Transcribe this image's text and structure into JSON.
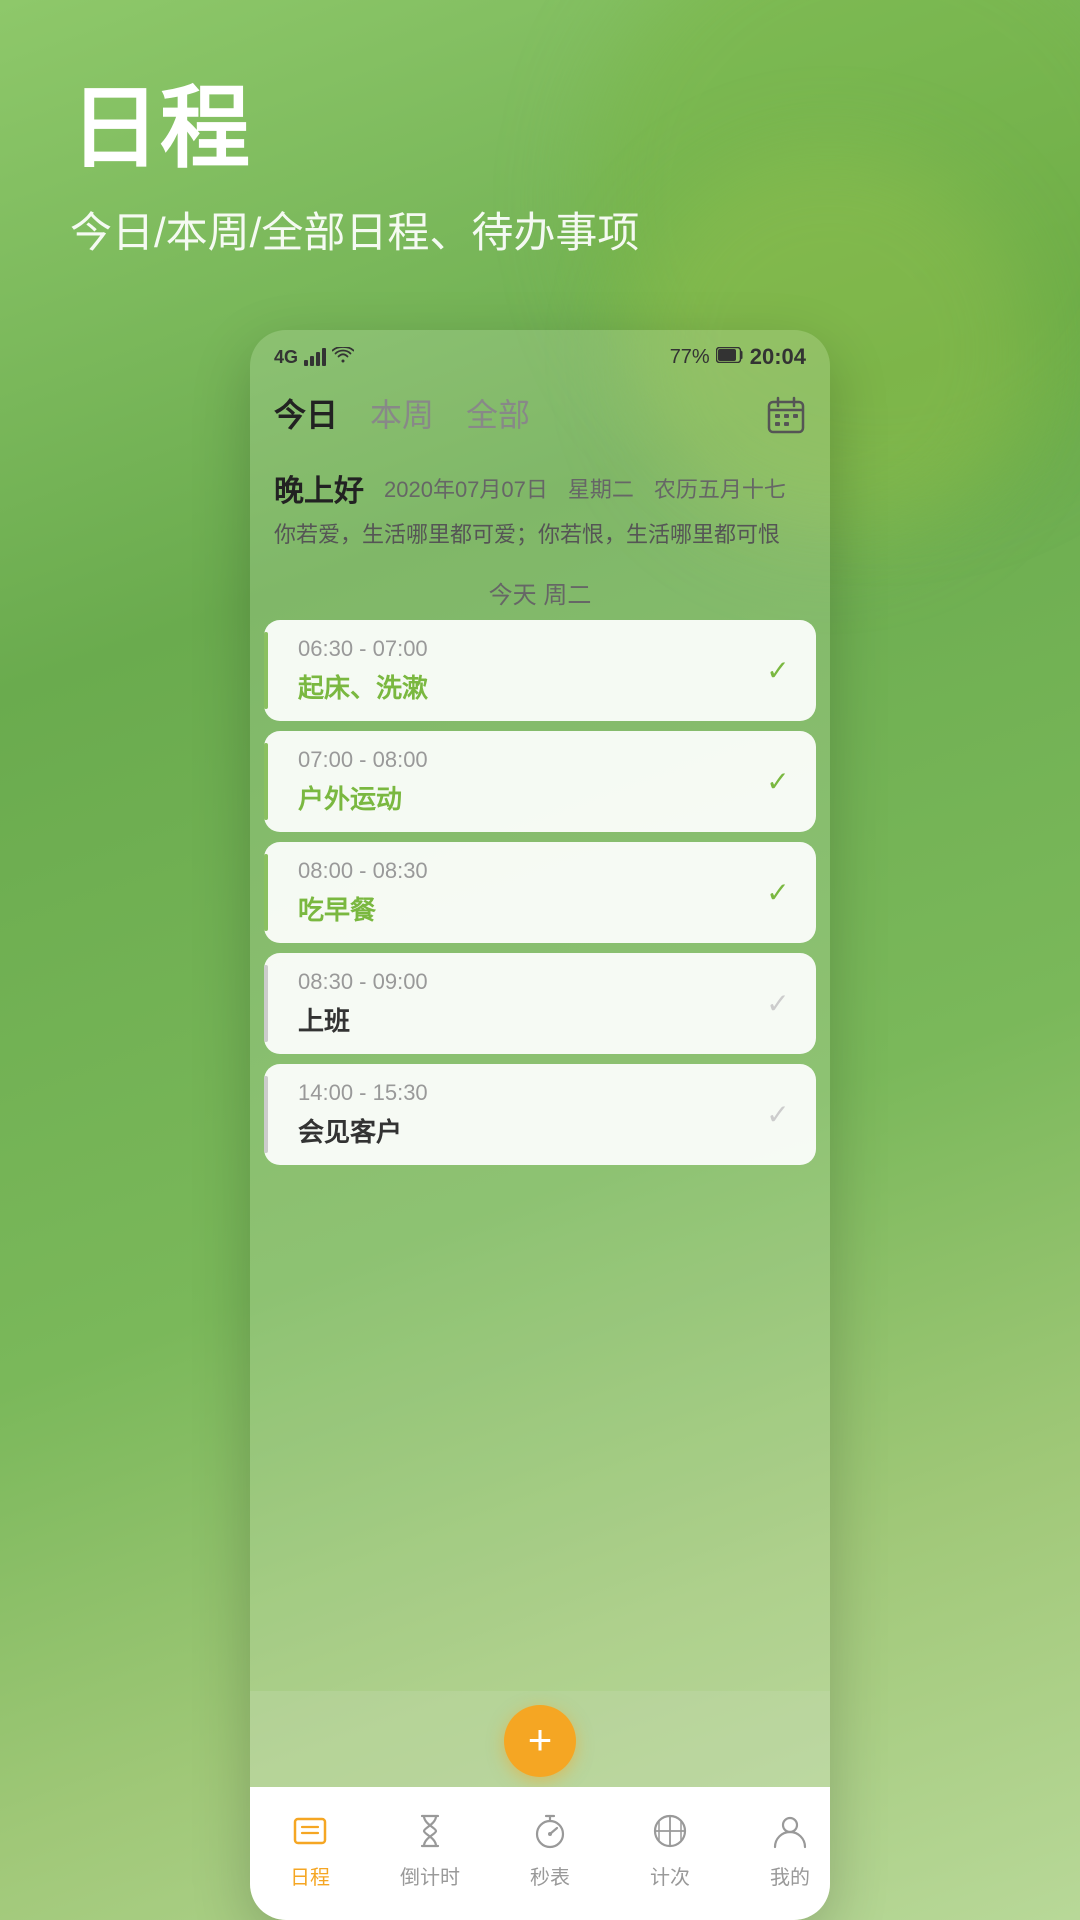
{
  "header": {
    "title": "日程",
    "subtitle": "今日/本周/全部日程、待办事项"
  },
  "phone": {
    "status_bar": {
      "signal": "4G",
      "battery": "77%",
      "time": "20:04"
    },
    "tabs": [
      {
        "id": "today",
        "label": "今日",
        "active": true
      },
      {
        "id": "week",
        "label": "本周",
        "active": false
      },
      {
        "id": "all",
        "label": "全部",
        "active": false
      }
    ],
    "calendar_icon": "calendar-icon",
    "greeting": {
      "text": "晚上好",
      "date": "2020年07月07日",
      "weekday": "星期二",
      "lunar": "农历五月十七",
      "quote": "你若爱，生活哪里都可爱；你若恨，生活哪里都可恨"
    },
    "today_label": "今天 周二",
    "schedules": [
      {
        "id": 1,
        "time": "06:30 - 07:00",
        "title": "起床、洗漱",
        "completed": true,
        "border_color": "green"
      },
      {
        "id": 2,
        "time": "07:00 - 08:00",
        "title": "户外运动",
        "completed": true,
        "border_color": "green"
      },
      {
        "id": 3,
        "time": "08:00 - 08:30",
        "title": "吃早餐",
        "completed": true,
        "border_color": "green"
      },
      {
        "id": 4,
        "time": "08:30 - 09:00",
        "title": "上班",
        "completed": false,
        "border_color": "grey"
      },
      {
        "id": 5,
        "time": "14:00 - 15:30",
        "title": "会见客户",
        "completed": false,
        "border_color": "grey"
      }
    ],
    "fab_label": "+",
    "bottom_nav": [
      {
        "id": "schedule",
        "label": "日程",
        "icon": "list-icon",
        "active": true
      },
      {
        "id": "countdown",
        "label": "倒计时",
        "icon": "hourglass-icon",
        "active": false
      },
      {
        "id": "stopwatch",
        "label": "秒表",
        "icon": "stopwatch-icon",
        "active": false
      },
      {
        "id": "counter",
        "label": "计次",
        "icon": "counter-icon",
        "active": false
      },
      {
        "id": "profile",
        "label": "我的",
        "icon": "profile-icon",
        "active": false
      }
    ]
  }
}
